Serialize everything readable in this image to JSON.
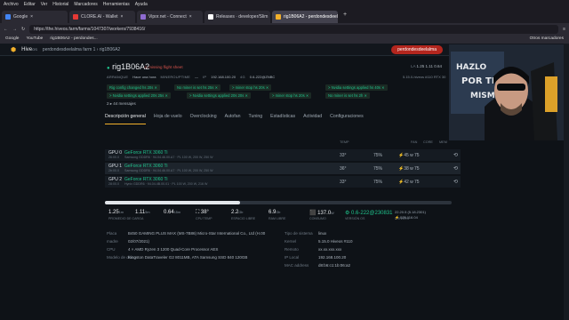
{
  "browser": {
    "menu": [
      "Archivo",
      "Editar",
      "Ver",
      "Historial",
      "Marcadores",
      "Herramientas",
      "Ayuda"
    ],
    "tabs": [
      {
        "label": "Google",
        "color": "#4285f4"
      },
      {
        "label": "CLORE.AI - Wallet",
        "color": "#e53935"
      },
      {
        "label": "Vipor.net - Connect",
        "color": "#8e6bd1"
      },
      {
        "label": "Releases · developer/Slim",
        "color": "#ffffff"
      },
      {
        "label": "rig1B06A2 - perdondesdeelam",
        "color": "#f2b02b"
      }
    ],
    "url": "https://the.hiveos.farm/farms/1047307/workers/7938416/",
    "bookmarks": [
      "Google",
      "YouTube",
      "rig1B06A2 - perdondes..."
    ],
    "bookmarks_right": "Otros marcadores"
  },
  "app": {
    "brand": "Hive",
    "brand_os": "OS",
    "breadcrumb": "perdondesdeelalma farm 1  ›  rig1B06A2",
    "button": "perdondesdeelalma"
  },
  "rig": {
    "title": "rig1B06A2",
    "tag": "missing flight sheet",
    "meta_labels": [
      "ARRANQUE",
      "MINEROUPTIME",
      "IP",
      "4G"
    ],
    "meta_values": [
      "Hace una hora",
      "—",
      "192.168.100.20",
      "0.6-222@ZNBC"
    ],
    "la_label": "LA",
    "la_value": "1.25 1.11 0.64",
    "right_meta": "5.15.0-hiveos  #110    RTX 30"
  },
  "notifications": [
    "Rig config changed hs 20s ✕",
    "No miner is set hs 25s ✕",
    "> miner stop hs 20s ✕",
    "> Nvidia settings applied hs 40s ✕",
    "> Nvidia settings applied 20s 25s ✕",
    "> Nvidia settings applied 20s 20s ✕",
    "> miner stop hs 20s ✕",
    "No miner is set hs 2h ✕"
  ],
  "messages_label": "2 ▸ 44 mensajes",
  "tabs": [
    "Descripción general",
    "Hoja de vuelo",
    "Overclocking",
    "Autofan",
    "Tuning",
    "Estadísticas",
    "Actividad",
    "Configuraciones"
  ],
  "gpu_headers": [
    "TEMP",
    "FAN",
    "CORE",
    "MEM"
  ],
  "gpus": [
    {
      "name": "GPU 0",
      "sub": "26:00.0",
      "model": "GeForce RTX 3060 Ti",
      "mem": "8192 MB · Gigabyte",
      "details": "Samsung GDDR6 · 94.04.46.00.A7 · PL 100 W, 200 W, 250 W",
      "temp": "33°",
      "fan": "75%",
      "power": "⚡45 w",
      "core": "75"
    },
    {
      "name": "GPU 1",
      "sub": "2b:00.0",
      "model": "GeForce RTX 3060 Ti",
      "mem": "8192 MB · Gigabyte",
      "details": "Samsung GDDR6 · 94.04.46.00.A7 · PL 100 W, 200 W, 250 W",
      "temp": "36°",
      "fan": "75%",
      "power": "⚡38 w",
      "core": "75"
    },
    {
      "name": "GPU 2",
      "sub": "28:00.0",
      "model": "GeForce RTX 3060 Ti",
      "mem": "8192 MB · ASUS",
      "details": "Hynix GDDR6 · 94.04.4B.00.01 · PL 100 W, 200 W, 216 W",
      "temp": "33°",
      "fan": "75%",
      "power": "⚡42 w",
      "core": "75"
    }
  ],
  "progress_fraction": 0.39,
  "stats": [
    {
      "value": "1.25",
      "unit": "1m",
      "label": "PROMEDIO DE CARGA"
    },
    {
      "value": "1.11",
      "unit": "5m",
      "label": ""
    },
    {
      "value": "0.64",
      "unit": "15m",
      "label": ""
    },
    {
      "value": "⛶ 38°",
      "unit": "",
      "label": "CPU TEMP"
    },
    {
      "value": "2.2",
      "unit": "Gb",
      "label": "ESPACIO LIBRE"
    },
    {
      "value": "6.9",
      "unit": "Gb",
      "label": "RAM LIBRE"
    },
    {
      "value": "⬛ 137.0",
      "unit": "W",
      "label": "CONSUMO"
    },
    {
      "value": "⚙ 0.6-222@230831",
      "unit": "",
      "label": "VERSIÓN OS"
    },
    {
      "value": "22.20.5 (5.18.2301)",
      "unit": "",
      "label": "DRIVERS"
    }
  ],
  "stats_sub": "⚡ 525.116.04",
  "info_left": [
    {
      "k": "Placa",
      "v": "B450 GAMING PLUS MAX (MS-7B86) Micro-Star International Co., Ltd (H.00"
    },
    {
      "k": "madre",
      "v": "02/07/2021)"
    },
    {
      "k": "CPU",
      "v": "4 × AMD Ryzen 3 1200 Quad-Core Processor AES"
    },
    {
      "k": "Modelo de disco",
      "v": "Kingston DataTraveler G2 8011MB, ATA Samsung SSD 840 120GB"
    }
  ],
  "info_right": [
    {
      "k": "Tipo de sistema",
      "v": "linux"
    },
    {
      "k": "Kernel",
      "v": "5.15.0 Hiveos #110"
    },
    {
      "k": "Remoto",
      "v": "xx.xx.xxx.xxx"
    },
    {
      "k": "IP Local",
      "v": "192.168.100.20"
    },
    {
      "k": "MAC address",
      "v": "d8:b6:c1:1b:06:a2"
    }
  ],
  "colors": {
    "accent": "#f2b02b",
    "green": "#1fc38c",
    "red": "#b3261e"
  }
}
